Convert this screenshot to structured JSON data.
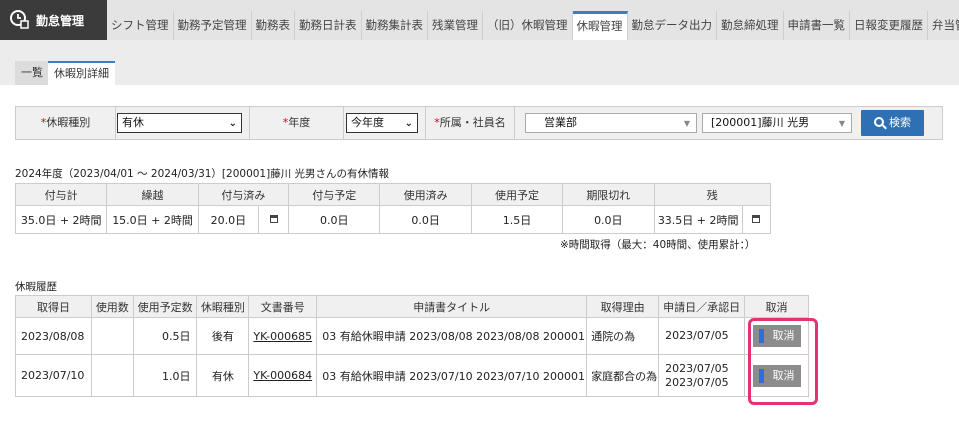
{
  "app": {
    "title": "勤怠管理"
  },
  "nav_tabs": [
    {
      "label": "シフト管理",
      "active": false
    },
    {
      "label": "勤務予定管理",
      "active": false
    },
    {
      "label": "勤務表",
      "active": false
    },
    {
      "label": "勤務日計表",
      "active": false
    },
    {
      "label": "勤務集計表",
      "active": false
    },
    {
      "label": "残業管理",
      "active": false
    },
    {
      "label": "（旧）休暇管理",
      "active": false
    },
    {
      "label": "休暇管理",
      "active": true
    },
    {
      "label": "勤怠データ出力",
      "active": false
    },
    {
      "label": "勤怠締処理",
      "active": false
    },
    {
      "label": "申請書一覧",
      "active": false
    },
    {
      "label": "日報変更履歴",
      "active": false
    },
    {
      "label": "弁当管理",
      "active": false
    }
  ],
  "sub_tabs": [
    {
      "label": "一覧",
      "active": false
    },
    {
      "label": "休暇別詳細",
      "active": true
    }
  ],
  "search": {
    "leave_type_label": "休暇種別",
    "leave_type_value": "有休",
    "year_label": "年度",
    "year_value": "今年度",
    "dept_label": "所属・社員名",
    "dept_value": "営業部",
    "employee_value": "[200001]藤川 光男",
    "required_mark": "*",
    "search_button": "検索"
  },
  "summary": {
    "caption": "2024年度（2023/04/01 ～ 2024/03/31）[200001]藤川 光男さんの有休情報",
    "headers": [
      "付与計",
      "繰越",
      "付与済み",
      "付与予定",
      "使用済み",
      "使用予定",
      "期限切れ",
      "残"
    ],
    "values": {
      "granted_total": "35.0日 + 2時間",
      "carryover": "15.0日 + 2時間",
      "granted": "20.0日",
      "grant_planned": "0.0日",
      "used": "0.0日",
      "use_planned": "1.5日",
      "expired": "0.0日",
      "remaining": "33.5日 + 2時間"
    },
    "note": "※時間取得（最大：40時間、使用累計：）"
  },
  "history": {
    "caption": "休暇履歴",
    "headers": [
      "取得日",
      "使用数",
      "使用予定数",
      "休暇種別",
      "文書番号",
      "申請書タイトル",
      "取得理由",
      "申請日／承認日",
      "取消"
    ],
    "rows": [
      {
        "date": "2023/08/08",
        "used": "",
        "planned": "0.5日",
        "type": "後有",
        "doc": "YK-000685",
        "title": "03 有給休暇申請 2023/08/08 2023/08/08 200001",
        "reason": "通院の為",
        "apply_date": "2023/07/05",
        "approve_date": "",
        "cancel": "取消"
      },
      {
        "date": "2023/07/10",
        "used": "",
        "planned": "1.0日",
        "type": "有休",
        "doc": "YK-000684",
        "title": "03 有給休暇申請 2023/07/10 2023/07/10 200001",
        "reason": "家庭都合の為",
        "apply_date": "2023/07/05",
        "approve_date": "2023/07/05",
        "cancel": "取消"
      }
    ]
  },
  "colors": {
    "brand_bg": "#3b3b3b",
    "accent": "#3e7cc4",
    "search_button": "#2f6fb4",
    "required": "#d0021b",
    "highlight": "#e33373",
    "cancel_button": "#8c8c8c"
  }
}
